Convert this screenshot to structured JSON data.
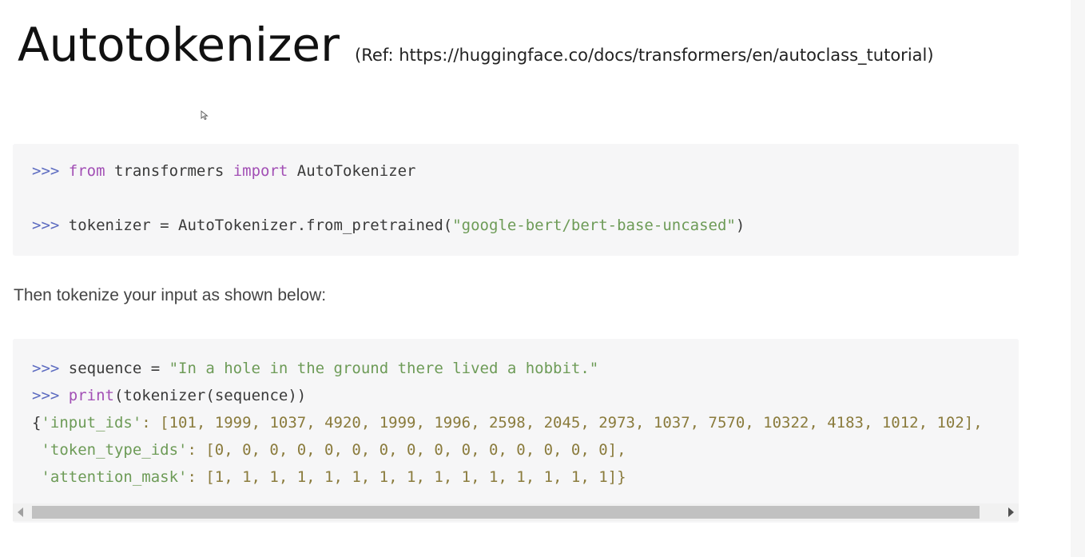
{
  "heading": {
    "title": "Autotokenizer",
    "ref": "(Ref: https://huggingface.co/docs/transformers/en/autoclass_tutorial)"
  },
  "code_block_1": {
    "line1": {
      "prompt": ">>>",
      "kw_from": "from",
      "module": " transformers ",
      "kw_import": "import",
      "name": " AutoTokenizer"
    },
    "line2": {
      "prompt": ">>>",
      "code": " tokenizer = AutoTokenizer.from_pretrained(",
      "string": "\"google-bert/bert-base-uncased\"",
      "close": ")"
    }
  },
  "prose": {
    "text": "Then tokenize your input as shown below:"
  },
  "code_block_2": {
    "line1": {
      "prompt": ">>>",
      "code": " sequence = ",
      "string": "\"In a hole in the ground there lived a hobbit.\""
    },
    "line2": {
      "prompt": ">>>",
      "kw_print": "print",
      "code": "(tokenizer(sequence))"
    },
    "line3": {
      "open": "{",
      "key": "'input_ids'",
      "values": ": [101, 1999, 1037, 4920, 1999, 1996, 2598, 2045, 2973, 1037, 7570, 10322, 4183, 1012, 102],"
    },
    "line4": {
      "key": " 'token_type_ids'",
      "values": ": [0, 0, 0, 0, 0, 0, 0, 0, 0, 0, 0, 0, 0, 0, 0],"
    },
    "line5": {
      "key": " 'attention_mask'",
      "values": ": [1, 1, 1, 1, 1, 1, 1, 1, 1, 1, 1, 1, 1, 1, 1]}"
    }
  },
  "scrollbar": {
    "position_fraction": 0.0,
    "visible_fraction": 0.97
  },
  "colors": {
    "prompt": "#5c6bc0",
    "keyword": "#a24fb5",
    "string": "#6d9b57",
    "code_background": "#f6f6f7"
  }
}
